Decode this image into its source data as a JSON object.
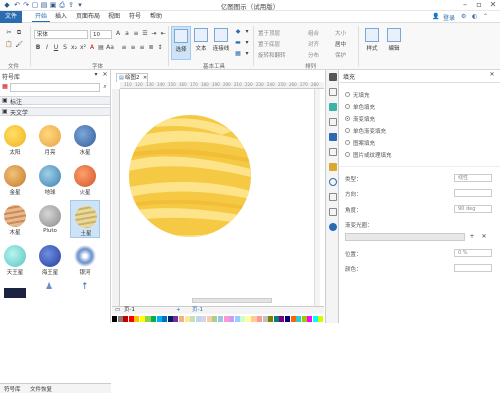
{
  "app": {
    "title": "亿图图示（试用版）"
  },
  "menu": {
    "file": "文件",
    "items": [
      "开始",
      "插入",
      "页面布局",
      "视图",
      "符号",
      "帮助"
    ],
    "login": "登录"
  },
  "ribbon": {
    "font_name": "宋体",
    "font_size": "10",
    "group_labels": {
      "file": "文件",
      "font": "字体",
      "basic_tools": "基本工具",
      "arrange": "排列"
    },
    "select": "选择",
    "text": "文本",
    "connector": "连接线",
    "arrange_cmds": [
      "置于顶层",
      "置于底层",
      "旋转和翻转",
      "组合",
      "对齐",
      "分布",
      "大小",
      "居中",
      "保护"
    ],
    "style": "样式",
    "edit": "编辑"
  },
  "library": {
    "title": "符号库",
    "search_placeholder": "",
    "sections": [
      "标注",
      "天文学"
    ],
    "items": [
      "太阳",
      "月亮",
      "水星",
      "金星",
      "地球",
      "火星",
      "木星",
      "Pluto",
      "土星",
      "天王星",
      "海王星",
      "银河"
    ],
    "bottom_tabs": [
      "符号库",
      "文件恢复"
    ]
  },
  "canvas": {
    "tab": "绘图2",
    "ruler_ticks": [
      "110",
      "120",
      "130",
      "140",
      "150",
      "160",
      "170",
      "180",
      "190",
      "200",
      "210",
      "220",
      "230",
      "240",
      "250",
      "260",
      "270",
      "280"
    ],
    "page_label": "页-1",
    "page_tab": "页-1",
    "palette": [
      "#000000",
      "#7f7f7f",
      "#c00000",
      "#ff0000",
      "#ffc000",
      "#ffff00",
      "#92d050",
      "#00b050",
      "#00b0f0",
      "#0070c0",
      "#002060",
      "#7030a0",
      "#f4b183",
      "#ffe699",
      "#c5e0b4",
      "#bdd7ee",
      "#d9d2e9",
      "#f8cbad",
      "#a9d18e",
      "#9dc3e6",
      "#ff99cc",
      "#cc99ff",
      "#99ccff",
      "#ccffcc",
      "#ffff99",
      "#ffcc99",
      "#ff9999",
      "#c0c0c0",
      "#808000",
      "#008080",
      "#800080",
      "#000080",
      "#ff6600",
      "#33cccc",
      "#99cc00",
      "#ff00ff",
      "#00ffff",
      "#ccff00"
    ]
  },
  "fill": {
    "title": "填充",
    "options": [
      "无填充",
      "单色填充",
      "渐变填充",
      "单色渐变填充",
      "图案填充",
      "图片或纹理填充"
    ],
    "selected_index": 2,
    "type_label": "类型：",
    "type_value": "线性",
    "direction_label": "方向：",
    "angle_label": "角度：",
    "angle_value": "90 deg",
    "stops_label": "渐变光圈：",
    "position_label": "位置：",
    "position_value": "0 %",
    "color_label": "颜色："
  },
  "colors": {
    "accent": "#2b6cb0",
    "planet_base": "#f6c944",
    "planet_light": "#fde38a"
  }
}
